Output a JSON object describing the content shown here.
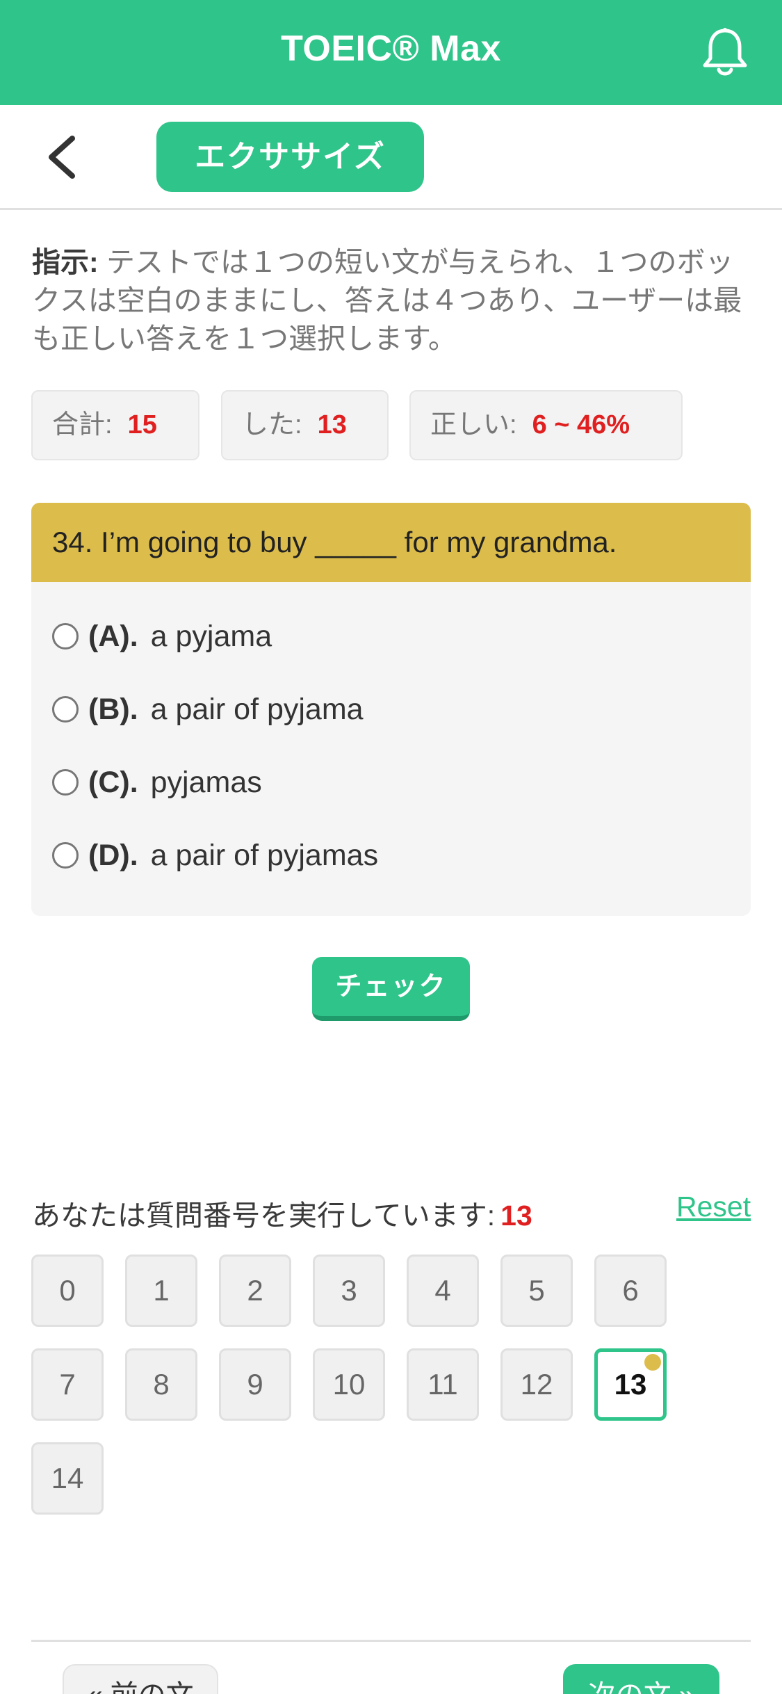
{
  "header": {
    "title": "TOEIC® Max",
    "bell_icon": "bell-icon"
  },
  "subbar": {
    "back_icon": "chevron-left-icon",
    "exercise_label": "エクササイズ"
  },
  "instructions": {
    "label": "指示:",
    "text": " テストでは１つの短い文が与えられ、１つのボックスは空白のままにし、答えは４つあり、ユーザーは最も正しい答えを１つ選択します。"
  },
  "stats": {
    "total_label": "合計:",
    "total_value": "15",
    "done_label": "した:",
    "done_value": "13",
    "correct_label": "正しい:",
    "correct_value": "6 ~ 46%"
  },
  "question": {
    "text": "34. I’m going to buy _____ for my grandma.",
    "options": [
      {
        "letter": "(A).",
        "text": "a pyjama"
      },
      {
        "letter": "(B).",
        "text": "a pair of pyjama"
      },
      {
        "letter": "(C).",
        "text": "pyjamas"
      },
      {
        "letter": "(D).",
        "text": "a pair of pyjamas"
      }
    ]
  },
  "check_label": "チェック",
  "progress": {
    "label": "あなたは質問番号を実行しています:",
    "current": "13",
    "reset_label": "Reset"
  },
  "numbers": [
    "0",
    "1",
    "2",
    "3",
    "4",
    "5",
    "6",
    "7",
    "8",
    "9",
    "10",
    "11",
    "12",
    "13",
    "14"
  ],
  "active_number": "13",
  "colors": {
    "accent": "#2ec48a",
    "question_header": "#dcbd4c",
    "highlight": "#e02020"
  },
  "nav": {
    "prev_label": "« 前の文",
    "next_label": "次の文 »"
  }
}
